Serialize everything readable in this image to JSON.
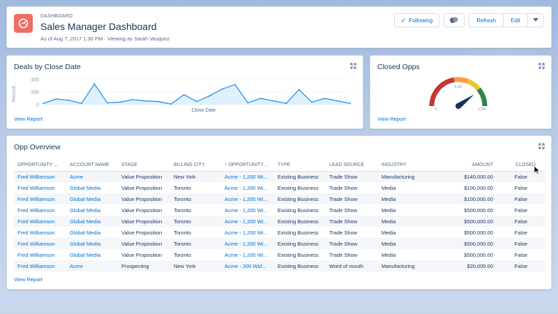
{
  "header": {
    "eyebrow": "DASHBOARD",
    "title": "Sales Manager Dashboard",
    "subtitle": "As of Aug 7, 2017 1:30 PM · Viewing as Sarah Vasquez",
    "following_label": "Following",
    "refresh_label": "Refresh",
    "edit_label": "Edit"
  },
  "deals_card": {
    "title": "Deals by Close Date",
    "view_report": "View Report",
    "chart_data": {
      "type": "line",
      "xlabel": "Close Date",
      "ylabel": "Record...",
      "yticks": [
        "400",
        "200",
        "0"
      ],
      "ylim": [
        0,
        400
      ],
      "values": [
        20,
        90,
        70,
        20,
        330,
        30,
        40,
        80,
        60,
        50,
        10,
        160,
        50,
        140,
        250,
        320,
        30,
        100,
        60,
        20,
        240,
        40,
        100,
        60,
        20
      ]
    }
  },
  "closed_card": {
    "title": "Closed Opps",
    "view_report": "View Report",
    "gauge": {
      "min_label": "0",
      "mid_label": "6.6K",
      "max_label": "1.3M",
      "value_fraction": 0.8,
      "colors": [
        "#c23934",
        "#ff9a3c",
        "#e6c62d",
        "#2e844a"
      ]
    }
  },
  "opp_card": {
    "title": "Opp Overview",
    "view_report": "View Report",
    "columns": [
      "OPPORTUNITY ...",
      "ACCOUNT NAME",
      "STAGE",
      "BILLING CITY",
      "↑ OPPORTUNITY ...",
      "TYPE",
      "LEAD SOURCE",
      "INDUSTRY",
      "AMOUNT",
      "CLOSED"
    ],
    "rows": [
      [
        "Fred Williamson",
        "Acme",
        "Value Proposition",
        "New York",
        "Acme - 1,200 Wi...",
        "Existing Business",
        "Trade Show",
        "Manufacturing",
        "$140,000.00",
        "False"
      ],
      [
        "Fred Williamson",
        "Global Media",
        "Value Proposition",
        "Toronto",
        "Acme - 1,200 Wi...",
        "Existing Business",
        "Trade Show",
        "Media",
        "$100,000.00",
        "False"
      ],
      [
        "Fred Williamson",
        "Global Media",
        "Value Proposition",
        "Toronto",
        "Acme - 1,200 Wi...",
        "Existing Business",
        "Trade Show",
        "Media",
        "$100,000.00",
        "False"
      ],
      [
        "Fred Williamson",
        "Global Media",
        "Value Proposition",
        "Toronto",
        "Acme - 1,200 Wi...",
        "Existing Business",
        "Trade Show",
        "Media",
        "$500,000.00",
        "False"
      ],
      [
        "Fred Williamson",
        "Global Media",
        "Value Proposition",
        "Toronto",
        "Acme - 1,200 Wi...",
        "Existing Business",
        "Trade Show",
        "Media",
        "$500,000.00",
        "False"
      ],
      [
        "Fred Williamson",
        "Global Media",
        "Value Proposition",
        "Toronto",
        "Acme - 1,200 Wi...",
        "Existing Business",
        "Trade Show",
        "Media",
        "$500,000.00",
        "False"
      ],
      [
        "Fred Williamson",
        "Global Media",
        "Value Proposition",
        "Toronto",
        "Acme - 1,200 Wi...",
        "Existing Business",
        "Trade Show",
        "Media",
        "$500,000.00",
        "False"
      ],
      [
        "Fred Williamson",
        "Global Media",
        "Value Proposition",
        "Toronto",
        "Acme - 1,200 Wi...",
        "Existing Business",
        "Trade Show",
        "Media",
        "$500,000.00",
        "False"
      ],
      [
        "Fred Williamson",
        "Acme",
        "Prospecting",
        "New York",
        "Acme - 200 Wid...",
        "Existing Business",
        "Word of mouth",
        "Manufacturing",
        "$20,000.00",
        "False"
      ]
    ]
  },
  "colors": {
    "link": "#0070d2",
    "text": "#16325c",
    "muted": "#54698d",
    "app_icon": "#ef6e64",
    "chart_line": "#1589ee",
    "chart_fill": "#d8ecfc"
  }
}
